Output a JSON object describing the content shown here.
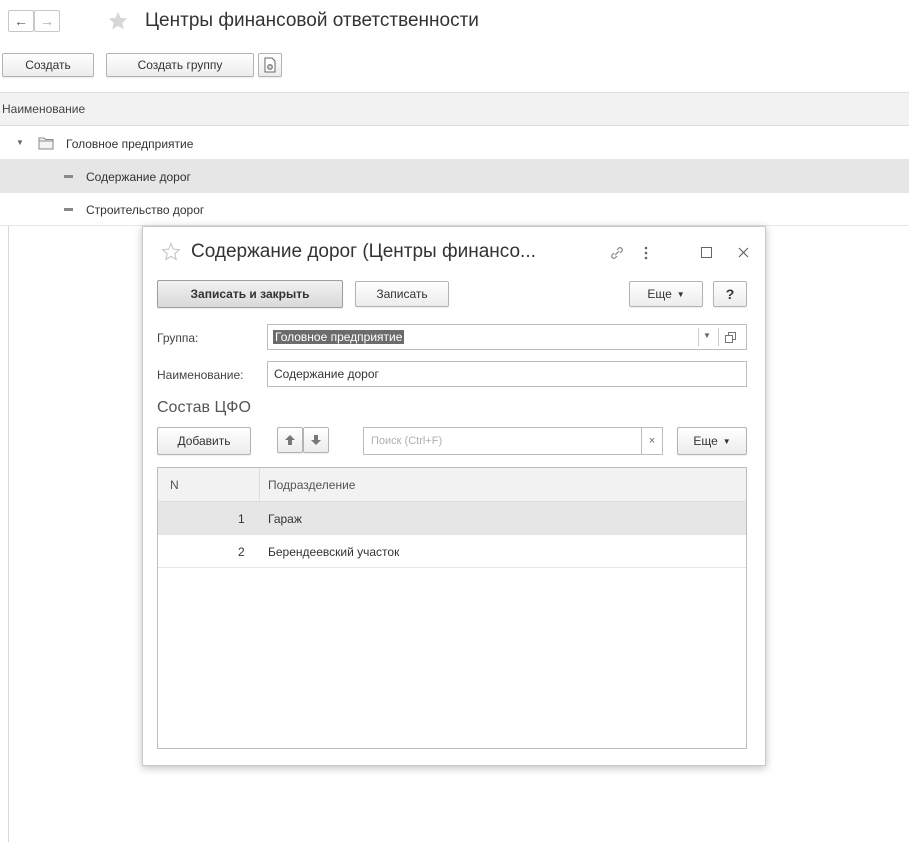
{
  "window": {
    "title": "Центры финансовой ответственности",
    "nav_back": "←",
    "nav_forward": "→"
  },
  "toolbar": {
    "create_label": "Создать",
    "create_group_label": "Создать группу"
  },
  "list": {
    "column_header": "Наименование",
    "tree": [
      {
        "label": "Головное предприятие",
        "kind": "group"
      },
      {
        "label": "Содержание дорог",
        "kind": "item",
        "selected": true
      },
      {
        "label": "Строительство дорог",
        "kind": "item"
      }
    ]
  },
  "dialog": {
    "title": "Содержание дорог (Центры финансо...",
    "save_close_label": "Записать и закрыть",
    "save_label": "Записать",
    "more_label": "Еще",
    "help_label": "?",
    "group_label": "Группа:",
    "group_value": "Головное предприятие",
    "name_label": "Наименование:",
    "name_value": "Содержание дорог",
    "section_title": "Состав ЦФО",
    "add_label": "Добавить",
    "search_placeholder": "Поиск (Ctrl+F)",
    "search_clear": "×",
    "more2_label": "Еще",
    "table": {
      "col_n": "N",
      "col_unit": "Подразделение",
      "rows": [
        {
          "n": "1",
          "unit": "Гараж",
          "selected": true
        },
        {
          "n": "2",
          "unit": "Берендеевский участок"
        }
      ]
    }
  },
  "colors": {
    "star_inactive": "#d6d6d6",
    "selected_row": "#e6e6e6",
    "header_bg": "#f2f2f2"
  }
}
